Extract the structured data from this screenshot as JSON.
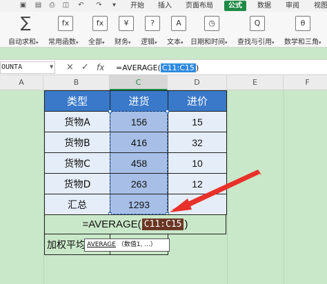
{
  "menu": {
    "tabs": [
      "开始",
      "插入",
      "页面布局",
      "公式",
      "数据",
      "审阅",
      "视图"
    ],
    "active_tab": "公式",
    "accent_color": "#1e8a45"
  },
  "ribbon": {
    "buttons": [
      {
        "label": "自动求和",
        "icon": "sigma-icon",
        "glyph": "∑"
      },
      {
        "label": "常用函数",
        "icon": "common-function-icon",
        "glyph": "fx"
      },
      {
        "label": "全部",
        "icon": "all-functions-icon",
        "glyph": "fx"
      },
      {
        "label": "财务",
        "icon": "finance-icon",
        "glyph": "¥"
      },
      {
        "label": "逻辑",
        "icon": "logic-icon",
        "glyph": "?"
      },
      {
        "label": "文本",
        "icon": "text-icon",
        "glyph": "A"
      },
      {
        "label": "日期和时间",
        "icon": "clock-icon",
        "glyph": "◷"
      },
      {
        "label": "查找与引用",
        "icon": "lookup-icon",
        "glyph": "Q"
      },
      {
        "label": "数学和三角",
        "icon": "math-icon",
        "glyph": "θ"
      }
    ]
  },
  "formula_bar": {
    "name_box": "OUNTA",
    "cancel_icon": "×",
    "confirm_icon": "✓",
    "fx_icon": "fx",
    "formula_prefix": "=AVERAGE(",
    "formula_ref": "C11:C15",
    "formula_suffix": ")"
  },
  "columns": [
    "A",
    "B",
    "C",
    "D",
    "E",
    "F"
  ],
  "selected_column": "C",
  "table": {
    "header": [
      "类型",
      "进货",
      "进价"
    ],
    "rows": [
      [
        "货物A",
        "156",
        "15"
      ],
      [
        "货物B",
        "416",
        "32"
      ],
      [
        "货物C",
        "458",
        "10"
      ],
      [
        "货物D",
        "263",
        "12"
      ],
      [
        "汇总",
        "1293",
        ""
      ]
    ],
    "merged_formula_prefix": "=AVERAGE(",
    "merged_formula_ref": "C11:C15",
    "merged_formula_suffix": ")",
    "last_row_label": "加权平均"
  },
  "tooltip": {
    "function": "AVERAGE",
    "args": "（数值1, ...）"
  },
  "colors": {
    "header_blue": "#3a79c9",
    "sheet_green": "#c9e8c9",
    "ref_dark": "#6b3624",
    "ref_highlight": "#2f8ae0",
    "arrow_red": "#e8312a"
  }
}
